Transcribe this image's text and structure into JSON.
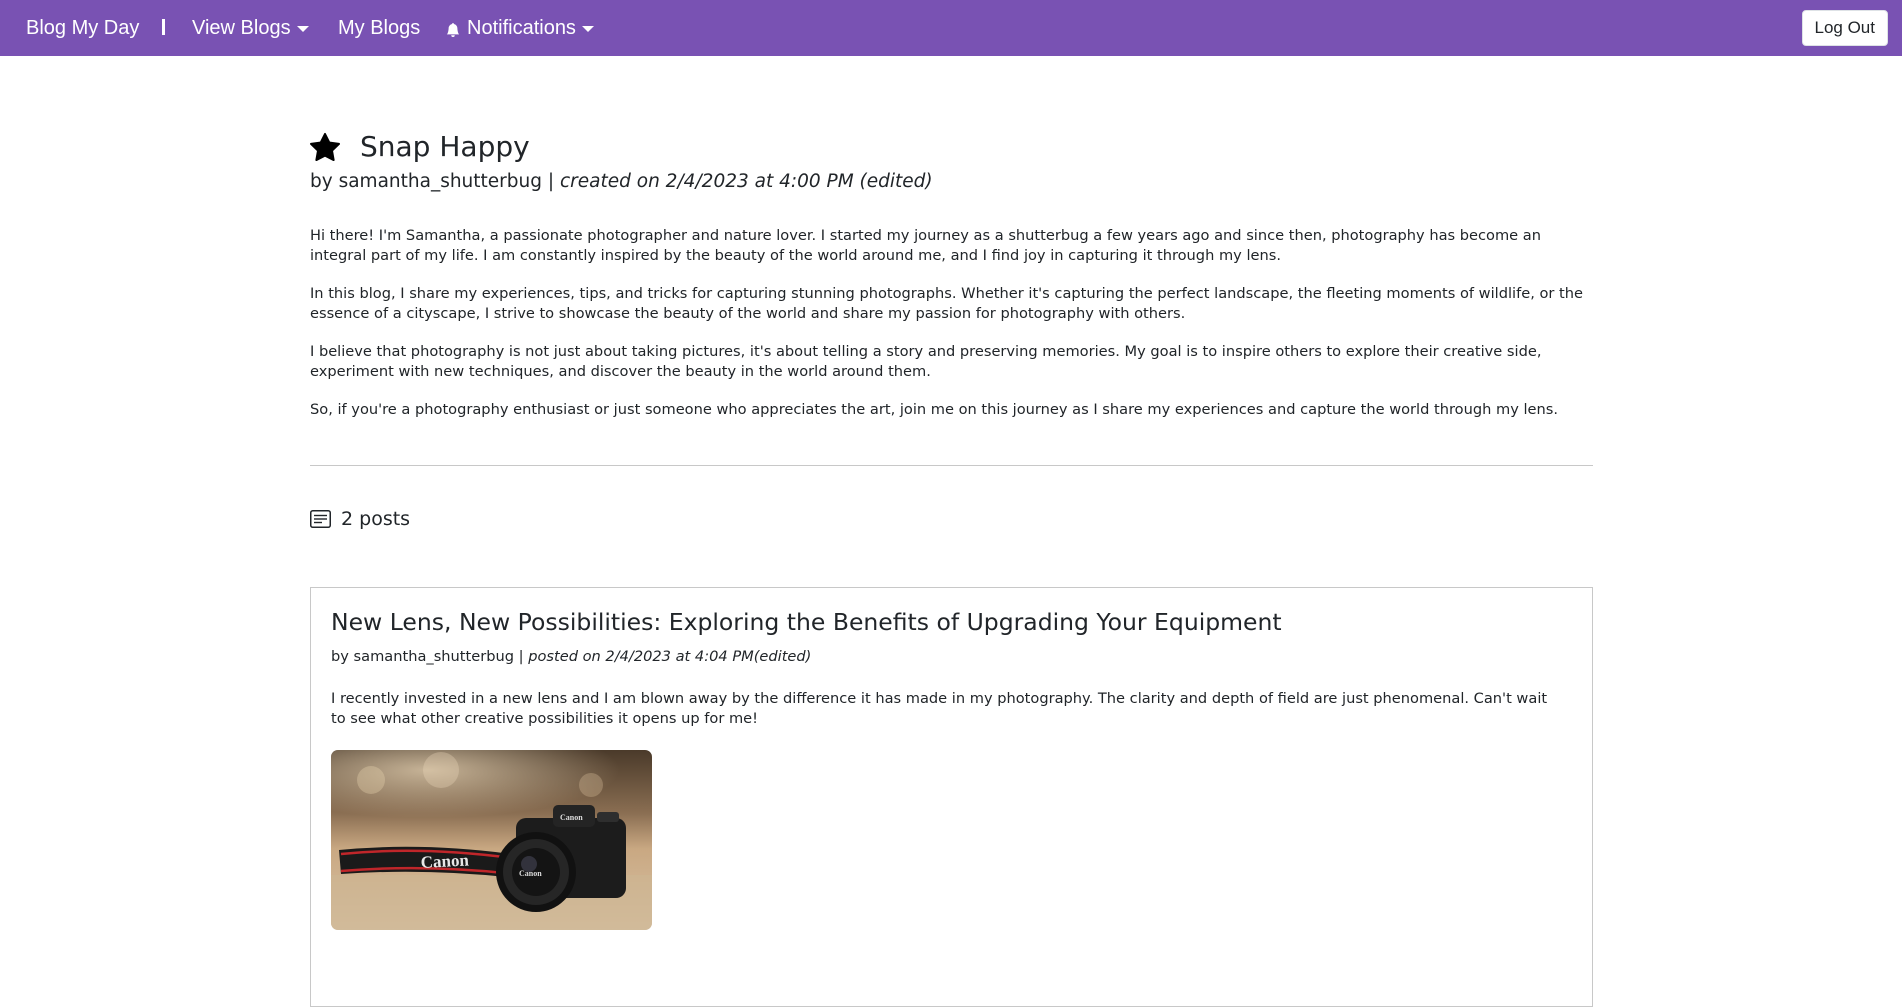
{
  "nav": {
    "brand": "Blog My Day",
    "view_blogs": "View Blogs",
    "my_blogs": "My Blogs",
    "notifications": "Notifications",
    "logout": "Log Out"
  },
  "colors": {
    "navbar": "#7952b3",
    "text": "#212529",
    "divider": "#c8c8c8"
  },
  "icons": {
    "favorite": "star-icon",
    "notifications": "bell-icon",
    "posts": "post-list-icon"
  },
  "blog": {
    "title": "Snap Happy",
    "author_prefix": "by samantha_shutterbug | ",
    "created": "created on 2/4/2023 at 4:00 PM (edited)",
    "description": [
      "Hi there! I'm Samantha, a passionate photographer and nature lover. I started my journey as a shutterbug a few years ago and since then, photography has become an integral part of my life. I am constantly inspired by the beauty of the world around me, and I find joy in capturing it through my lens.",
      "In this blog, I share my experiences, tips, and tricks for capturing stunning photographs. Whether it's capturing the perfect landscape, the fleeting moments of wildlife, or the essence of a cityscape, I strive to showcase the beauty of the world and share my passion for photography with others.",
      "I believe that photography is not just about taking pictures, it's about telling a story and preserving memories. My goal is to inspire others to explore their creative side, experiment with new techniques, and discover the beauty in the world around them.",
      "So, if you're a photography enthusiast or just someone who appreciates the art, join me on this journey as I share my experiences and capture the world through my lens."
    ]
  },
  "posts_count": "2 posts",
  "posts": [
    {
      "title": "New Lens, New Possibilities: Exploring the Benefits of Upgrading Your Equipment",
      "author_prefix": "by samantha_shutterbug | ",
      "posted": "posted on 2/4/2023 at 4:04 PM(edited)",
      "body": "I recently invested in a new lens and I am blown away by the difference it has made in my photography. The clarity and depth of field are just phenomenal. Can't wait to see what other creative possibilities it opens up for me!",
      "image": {
        "strap_text": "Canon",
        "body_text": "Canon",
        "lens_text": "Canon"
      }
    }
  ]
}
